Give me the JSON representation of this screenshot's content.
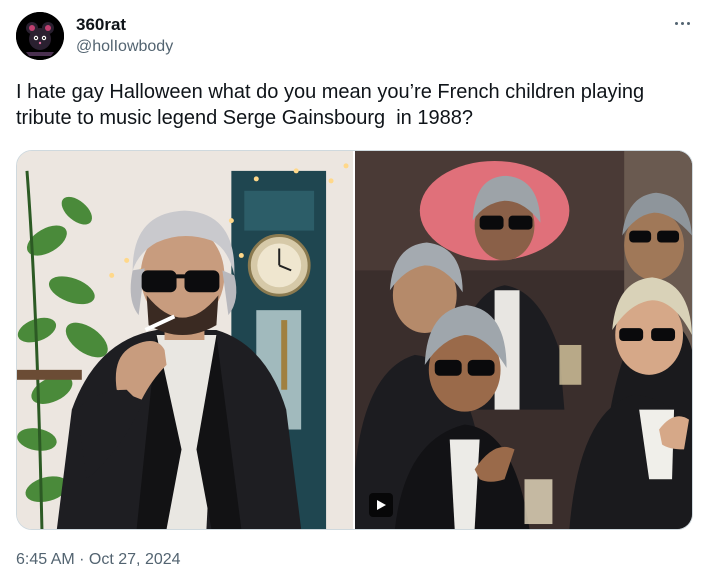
{
  "author": {
    "display_name": "360rat",
    "handle": "@holIowbody"
  },
  "tweet": {
    "text": "I hate gay Halloween what do you mean you’re French children playing tribute to music legend Serge Gainsbourg  in 1988?",
    "timestamp": "6:45 AM · Oct 27, 2024"
  },
  "icons": {
    "more": "more-options-icon",
    "play": "play-icon"
  },
  "colors": {
    "text": "#0f1419",
    "secondary": "#536471",
    "border": "#cfd9de"
  }
}
